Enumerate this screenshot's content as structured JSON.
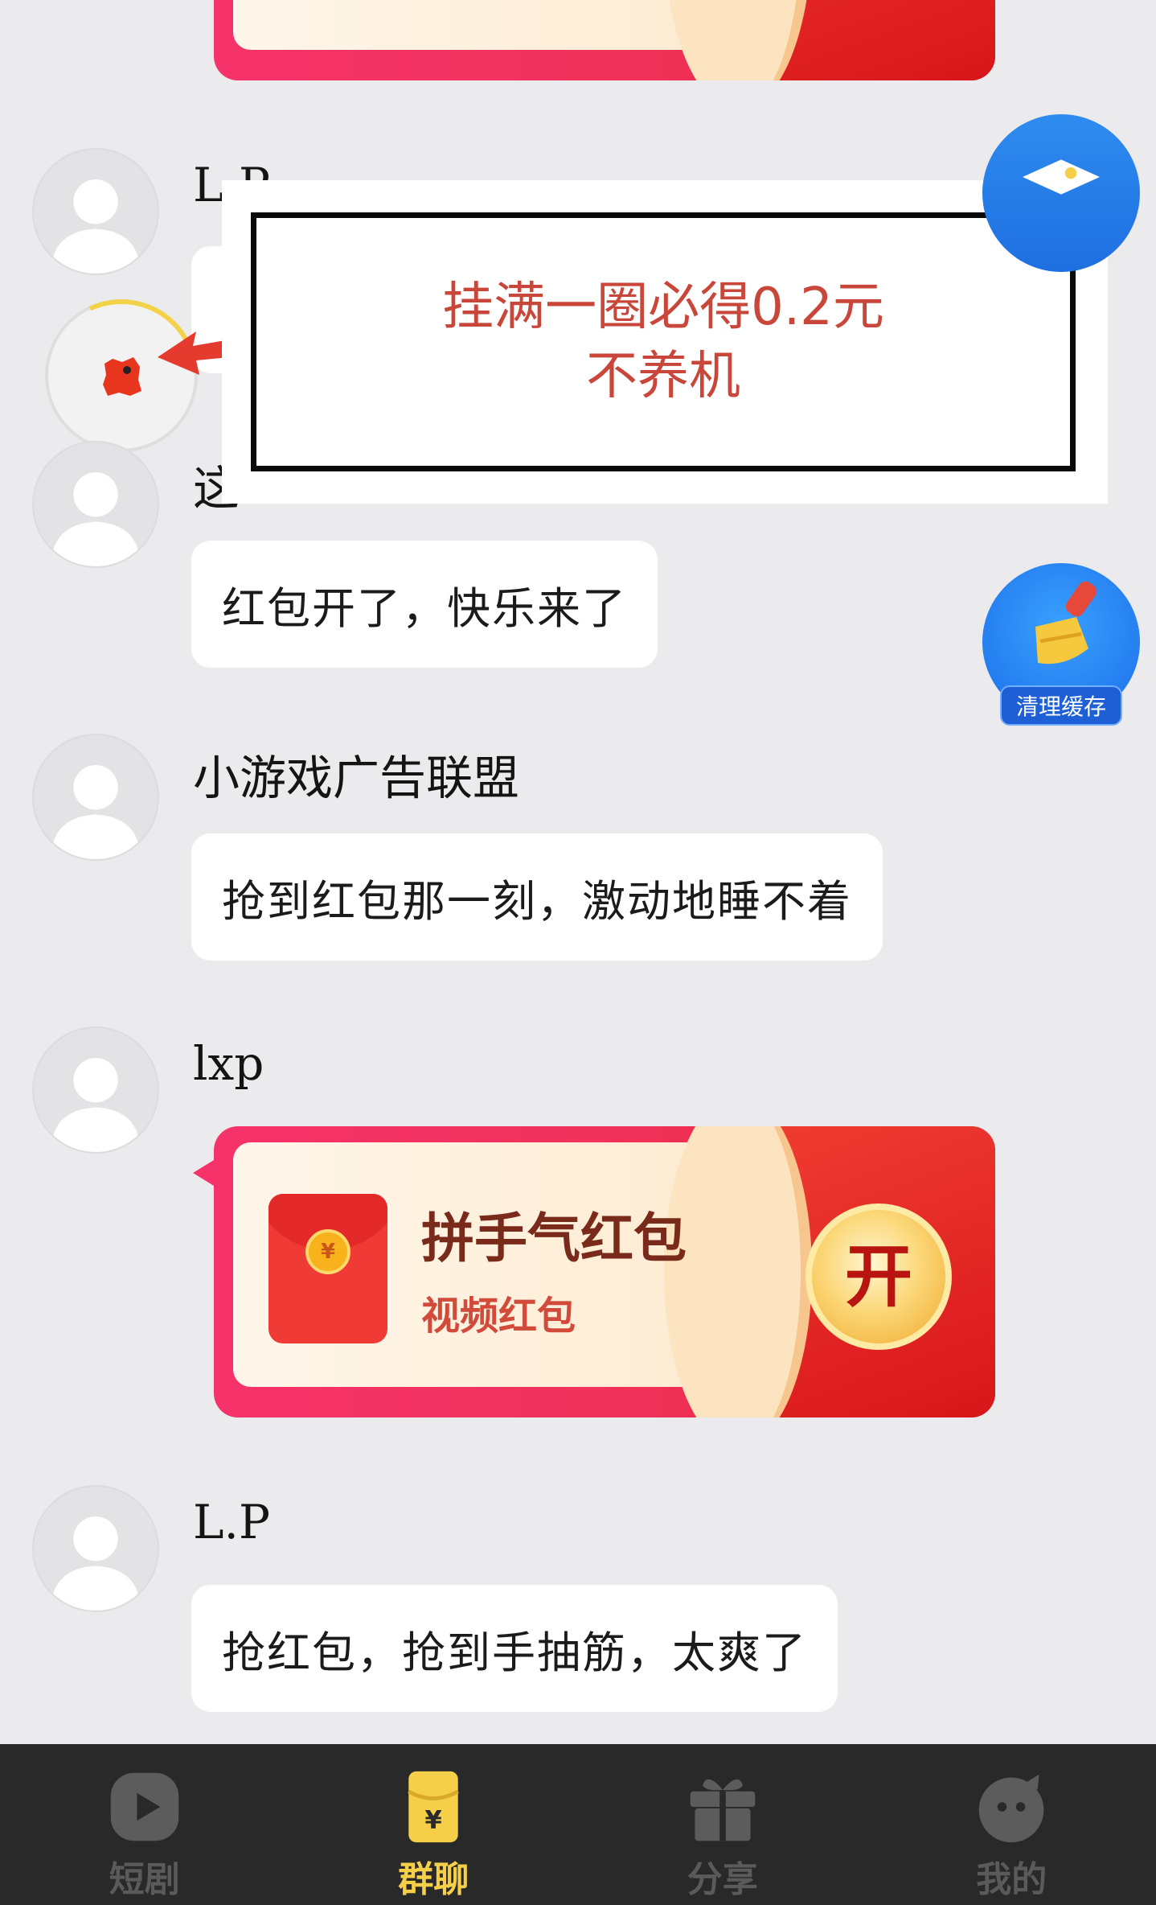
{
  "notice": {
    "line1": "挂满一圈必得0.2元",
    "line2": "不养机"
  },
  "messages": [
    {
      "sender": "L.P",
      "partial": true
    },
    {
      "sender": "这",
      "text": "红包开了，快乐来了"
    },
    {
      "sender": "小游戏广告联盟",
      "text": "抢到红包那一刻，激动地睡不着"
    },
    {
      "sender": "lxp",
      "red_packet": {
        "title": "拼手气红包",
        "subtitle": "视频红包",
        "open_label": "开"
      }
    },
    {
      "sender": "L.P",
      "text": "抢红包，抢到手抽筋，太爽了"
    }
  ],
  "clean_cache_label": "清理缓存",
  "coin_symbol": "¥",
  "bottom_nav": {
    "items": [
      {
        "label": "短剧",
        "icon": "play-icon",
        "active": false
      },
      {
        "label": "群聊",
        "icon": "red-packet-icon",
        "active": true
      },
      {
        "label": "分享",
        "icon": "gift-icon",
        "active": false
      },
      {
        "label": "我的",
        "icon": "profile-icon",
        "active": false
      }
    ]
  },
  "colors": {
    "background": "#ebebed",
    "accent": "#f6cf49",
    "notice_text": "#c8463a",
    "red_packet": "#e61c22"
  }
}
